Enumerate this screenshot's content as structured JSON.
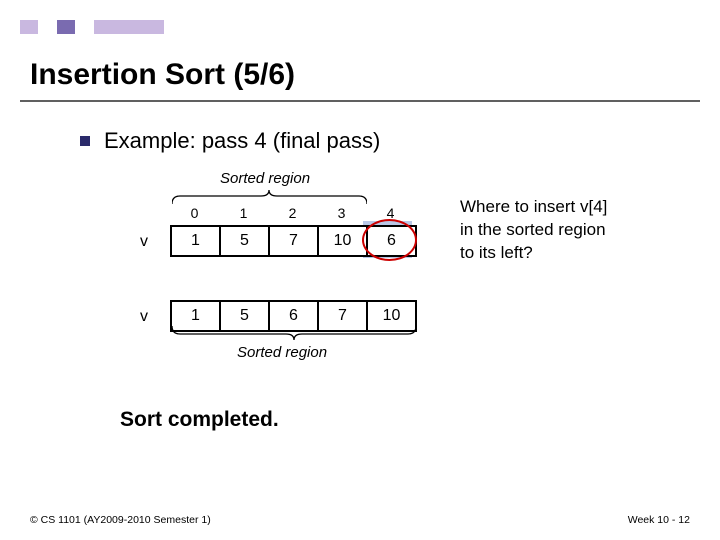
{
  "accent_colors": [
    "#c9b8e0",
    "#7a6bb0",
    "#c9b8e0"
  ],
  "title": "Insertion Sort (5/6)",
  "bullet": "Example: pass 4 (final pass)",
  "sorted_region_label": "Sorted region",
  "indices": [
    "0",
    "1",
    "2",
    "3",
    "4"
  ],
  "row1": {
    "label": "v",
    "values": [
      "1",
      "5",
      "7",
      "10",
      "6"
    ]
  },
  "row2": {
    "label": "v",
    "values": [
      "1",
      "5",
      "6",
      "7",
      "10"
    ]
  },
  "callout": {
    "l1": "Where to insert v[4]",
    "l2": "in the sorted region",
    "l3": "to its left?"
  },
  "completed": "Sort completed.",
  "footer_left": "© CS 1101 (AY2009-2010 Semester 1)",
  "footer_right": "Week 10 - 12"
}
